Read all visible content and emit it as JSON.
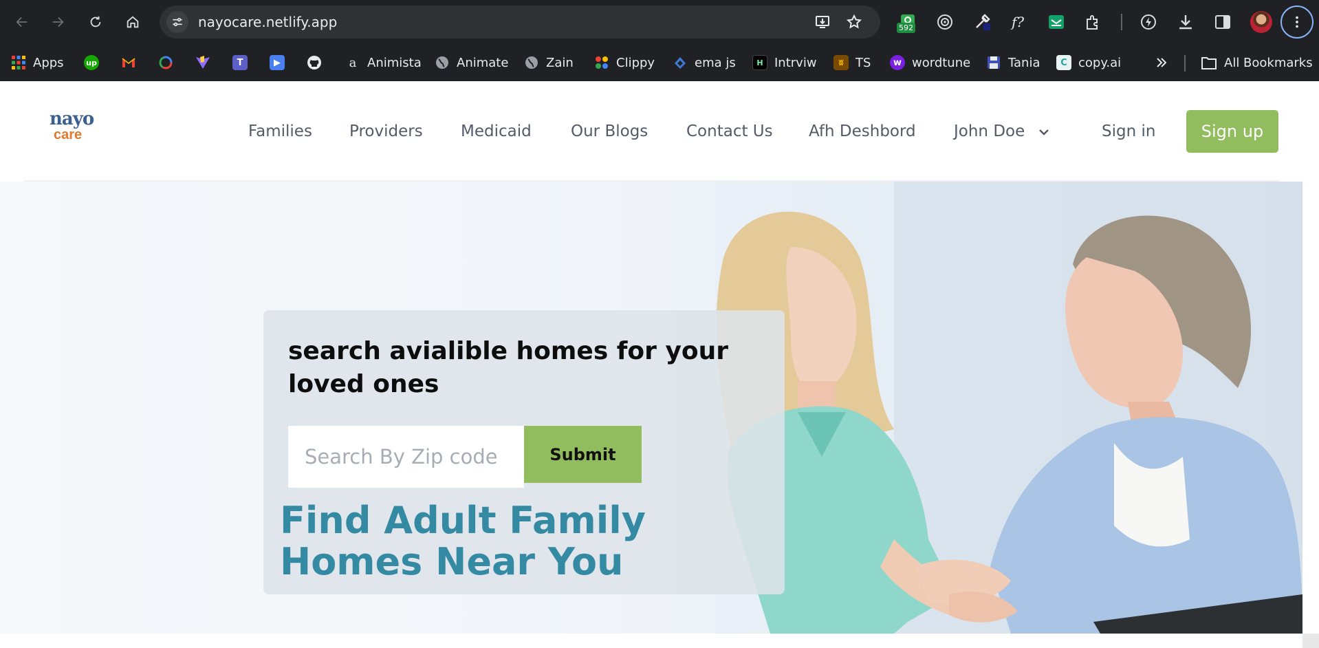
{
  "browser": {
    "url": "nayocare.netlify.app",
    "extension_badge": "592",
    "bookmarks": [
      {
        "label": "Apps",
        "icon": "apps-grid-icon"
      },
      {
        "label": "",
        "icon": "upwork-icon"
      },
      {
        "label": "",
        "icon": "gmail-icon"
      },
      {
        "label": "",
        "icon": "chrome-ring-icon"
      },
      {
        "label": "",
        "icon": "vite-icon"
      },
      {
        "label": "",
        "icon": "teams-icon"
      },
      {
        "label": "",
        "icon": "screencast-icon"
      },
      {
        "label": "",
        "icon": "github-icon"
      },
      {
        "label": "Animista",
        "icon": "animista-icon"
      },
      {
        "label": "Animate",
        "icon": "globe-icon"
      },
      {
        "label": "Zain",
        "icon": "globe-icon"
      },
      {
        "label": "Clippy",
        "icon": "clippy-icon"
      },
      {
        "label": "ema js",
        "icon": "emailjs-icon"
      },
      {
        "label": "Intrviw",
        "icon": "interview-icon"
      },
      {
        "label": "TS",
        "icon": "ts-icon"
      },
      {
        "label": "wordtune",
        "icon": "wordtune-icon"
      },
      {
        "label": "Tania",
        "icon": "floppy-icon"
      },
      {
        "label": "copy.ai",
        "icon": "copyai-icon"
      }
    ],
    "all_bookmarks_label": "All Bookmarks"
  },
  "site": {
    "logo_top": "nayo",
    "logo_sub": "care",
    "nav": [
      "Families",
      "Providers",
      "Medicaid",
      "Our Blogs",
      "Contact Us",
      "Afh Deshbord",
      "John Doe"
    ],
    "sign_in": "Sign in",
    "sign_up": "Sign up"
  },
  "hero": {
    "heading": "search avialible homes for your loved ones",
    "zip_placeholder": "Search By Zip code",
    "submit": "Submit",
    "title": "Find Adult Family Homes Near You"
  },
  "colors": {
    "accent_green": "#92bd5e",
    "title_teal": "#348aa2",
    "logo_orange": "#e2782c"
  }
}
